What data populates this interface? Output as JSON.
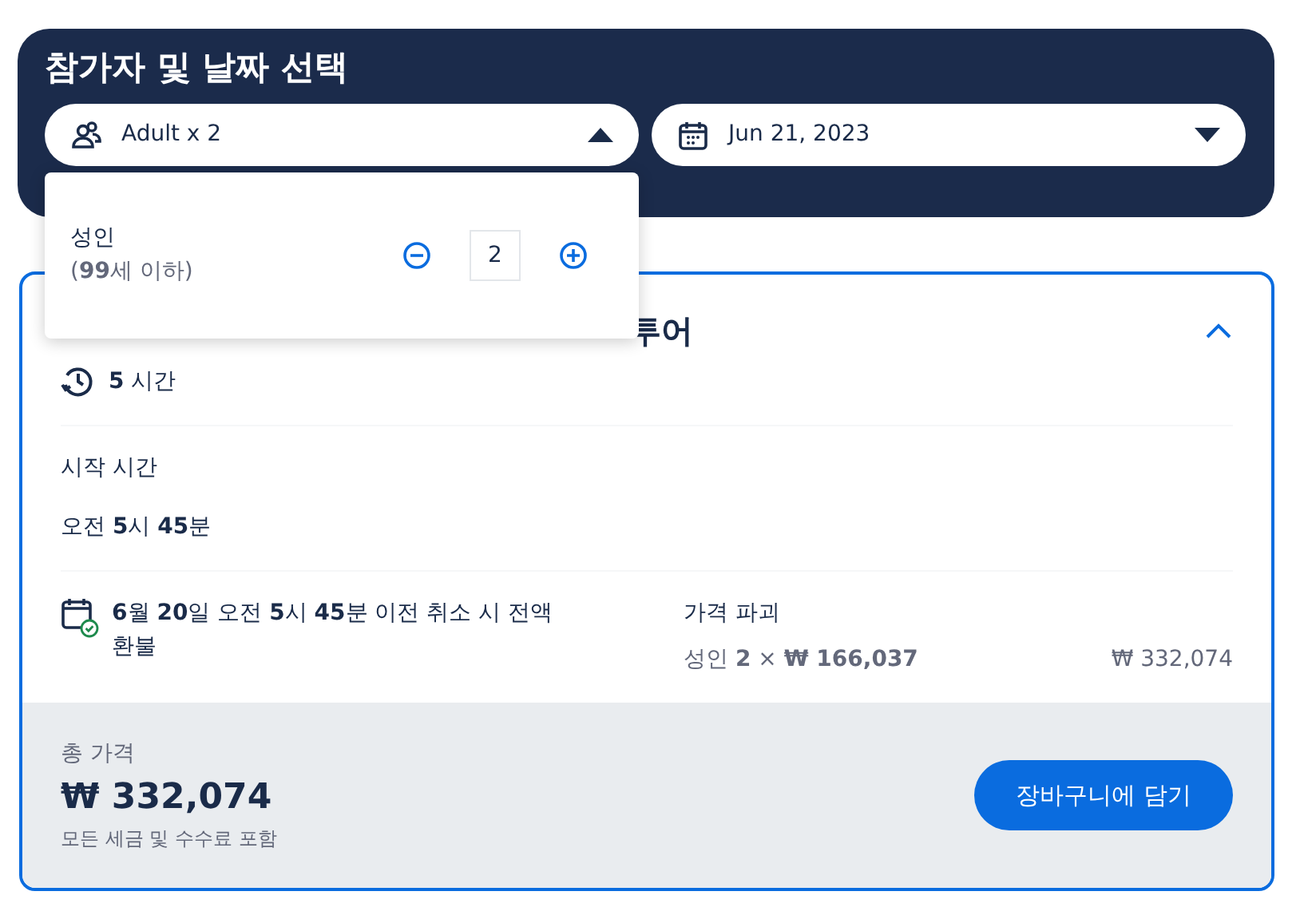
{
  "header": {
    "title": "참가자 및 날짜 선택"
  },
  "selectors": [
    {
      "kind": "people",
      "value": "Adult x 2",
      "expanded": true
    },
    {
      "kind": "date",
      "value": "Jun 21, 2023",
      "expanded": false
    }
  ],
  "participants_menu": {
    "label": "성인",
    "sublabel": "(**99**세 이하)",
    "count": "2"
  },
  "tour_card": {
    "title_visible": "투어",
    "expanded": true,
    "duration": "**5** 시간",
    "start_label": "시작 시간",
    "start_time": "오전 **5**시 **45**분",
    "cancellation": "**6**월 **20**일 오전 **5**시 **45**분 이전 취소 시 전액 환불",
    "breakdown_title": "가격 파괴",
    "breakdown_line": "성인 **2** × **₩ 166,037**",
    "breakdown_amount": "₩ 332,074"
  },
  "footer": {
    "total_label": "총 가격",
    "total": "₩ 332,074",
    "note": "모든 세금 및 수수료 포함",
    "button": "장바구니에 담기"
  }
}
